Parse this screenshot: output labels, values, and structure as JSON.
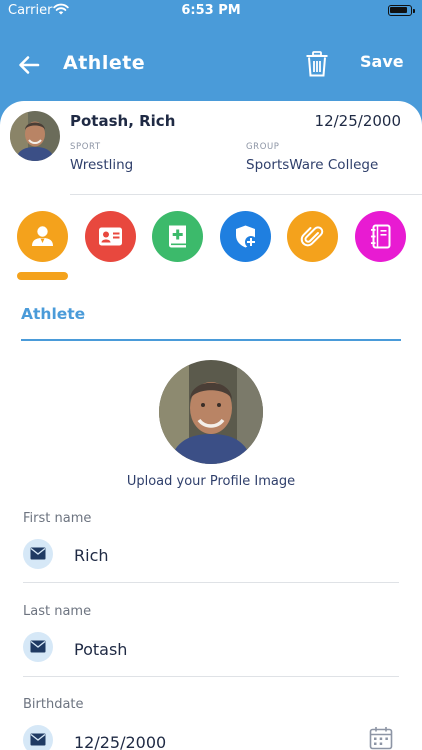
{
  "status_bar": {
    "carrier": "Carrier",
    "time": "6:53 PM"
  },
  "header": {
    "title": "Athlete",
    "save_label": "Save"
  },
  "profile": {
    "name": "Potash, Rich",
    "date": "12/25/2000",
    "sport_label": "SPORT",
    "sport": "Wrestling",
    "group_label": "GROUP",
    "group": "SportsWare College"
  },
  "tabs": [
    {
      "icon": "person-icon",
      "color": "#f4a21c"
    },
    {
      "icon": "contact-card-icon",
      "color": "#e8483e"
    },
    {
      "icon": "medical-book-icon",
      "color": "#3cba6b"
    },
    {
      "icon": "shield-plus-icon",
      "color": "#1f7fe0"
    },
    {
      "icon": "paperclip-icon",
      "color": "#f4a21c"
    },
    {
      "icon": "notebook-icon",
      "color": "#e81bd2"
    }
  ],
  "section": {
    "title": "Athlete",
    "upload_label": "Upload your Profile Image"
  },
  "form": {
    "first_name": {
      "label": "First name",
      "value": "Rich"
    },
    "last_name": {
      "label": "Last name",
      "value": "Potash"
    },
    "birthdate": {
      "label": "Birthdate",
      "value": "12/25/2000"
    }
  },
  "colors": {
    "header": "#4a9bd9",
    "accent": "#4a9bd9",
    "field_icon_bg": "#d6e8f7"
  }
}
